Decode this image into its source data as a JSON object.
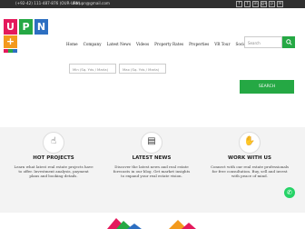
{
  "topbar": {
    "phone": "(+92-42) 111-487-876 (OUR-UPN)",
    "email": "ourupn@gmail.com",
    "social_icons": [
      "f",
      "t",
      "in",
      "g+",
      "p",
      "✉"
    ]
  },
  "logo": {
    "letters": [
      "U",
      "P",
      "N"
    ],
    "plus": "+"
  },
  "nav": {
    "items": [
      "Home",
      "Company",
      "Latest News",
      "Videos",
      "Property Rates",
      "Properties",
      "VR Tour",
      "Society Maps"
    ]
  },
  "search": {
    "placeholder": "Search",
    "icon": "search-icon"
  },
  "hero": {
    "select1": "Min (Sq. Yds / Marla)",
    "select2": "Max (Sq. Yds / Marla)",
    "submit": "SEARCH"
  },
  "cards": [
    {
      "icon": "hand-pointer-icon",
      "title": "HOT PROJECTS",
      "text": "Learn what latest real estate projects have to offer. Investment analysis, payment plans and booking details."
    },
    {
      "icon": "newspaper-icon",
      "title": "LATEST NEWS",
      "text": "Discover the latest news and real estate forecasts in our blog. Get market insights to expand your real estate vision."
    },
    {
      "icon": "handshake-icon",
      "title": "WORK WITH US",
      "text": "Connect with our real estate professionals for free consultation. Buy, sell and invest with peace of mind."
    }
  ],
  "colors": {
    "green": "#25a844",
    "pink": "#e4195c",
    "blue": "#2d6fc1",
    "orange": "#f39a1d",
    "dark": "#2f2f2f"
  }
}
